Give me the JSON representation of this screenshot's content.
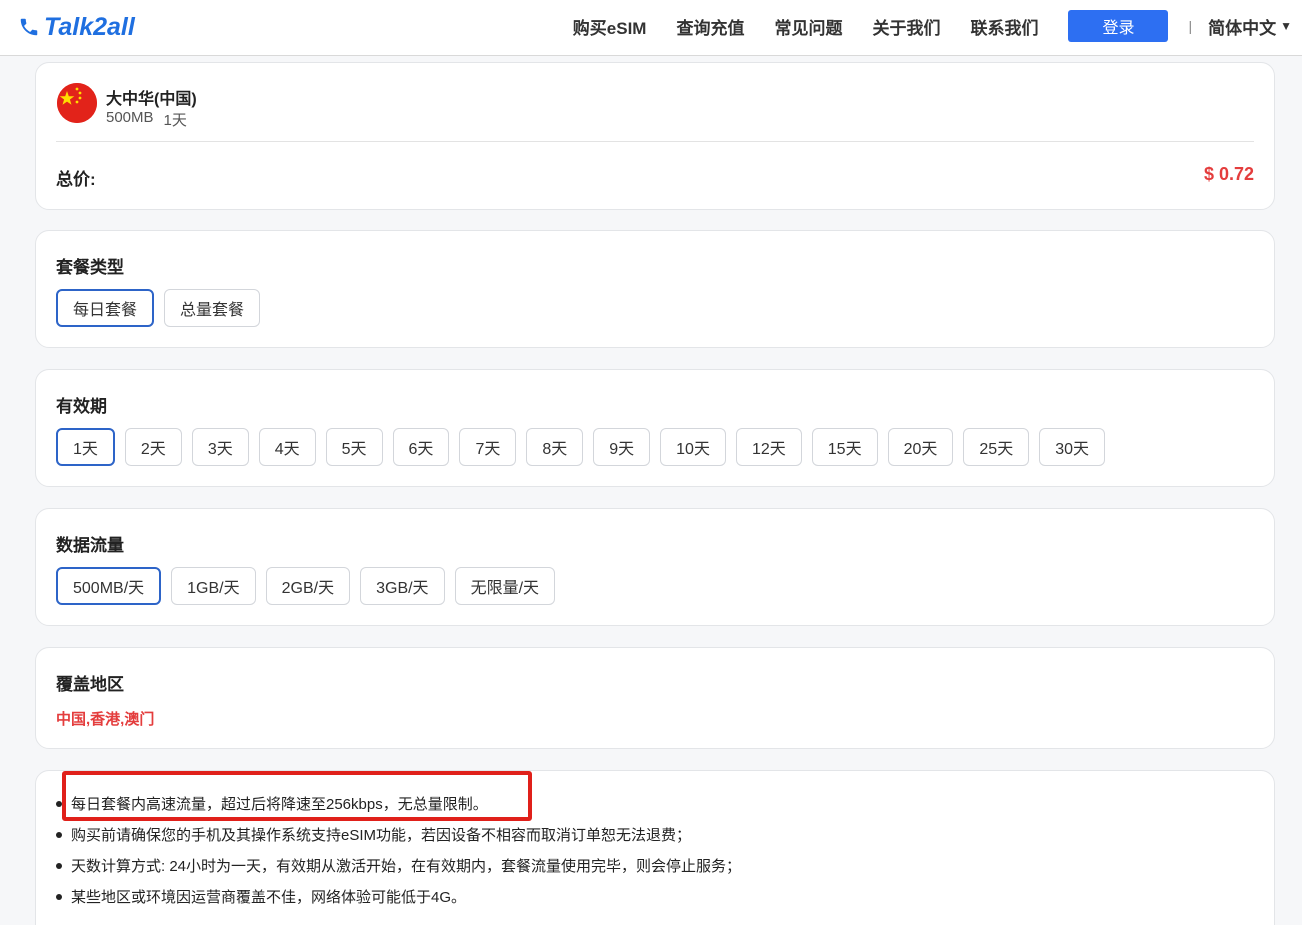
{
  "header": {
    "logo_text": "Talk2all",
    "nav": [
      "购买eSIM",
      "查询充值",
      "常见问题",
      "关于我们",
      "联系我们"
    ],
    "login_label": "登录",
    "divider": "|",
    "language": "简体中文"
  },
  "summary": {
    "plan_name": "大中华(中国)",
    "data": "500MB",
    "duration": "1天",
    "total_label": "总价:",
    "total_price": "$ 0.72"
  },
  "plan_type": {
    "title": "套餐类型",
    "options": [
      "每日套餐",
      "总量套餐"
    ],
    "selected": "每日套餐"
  },
  "validity": {
    "title": "有效期",
    "options": [
      "1天",
      "2天",
      "3天",
      "4天",
      "5天",
      "6天",
      "7天",
      "8天",
      "9天",
      "10天",
      "12天",
      "15天",
      "20天",
      "25天",
      "30天"
    ],
    "selected": "1天"
  },
  "data_volume": {
    "title": "数据流量",
    "options": [
      "500MB/天",
      "1GB/天",
      "2GB/天",
      "3GB/天",
      "无限量/天"
    ],
    "selected": "500MB/天"
  },
  "coverage": {
    "title": "覆盖地区",
    "regions": "中国,香港,澳门"
  },
  "notes": [
    "每日套餐内高速流量，超过后将降速至256kbps，无总量限制。",
    "购买前请确保您的手机及其操作系统支持eSIM功能，若因设备不相容而取消订单恕无法退费；",
    "天数计算方式: 24小时为一天，有效期从激活开始，在有效期内，套餐流量使用完毕，则会停止服务；",
    "某些地区或环境因运营商覆盖不佳，网络体验可能低于4G。"
  ],
  "colors": {
    "brand": "#1f6fe0",
    "login_button": "#2d6ff2",
    "price": "#e43d3d",
    "selected_border": "#2d64c8",
    "highlight": "#e0201a"
  }
}
